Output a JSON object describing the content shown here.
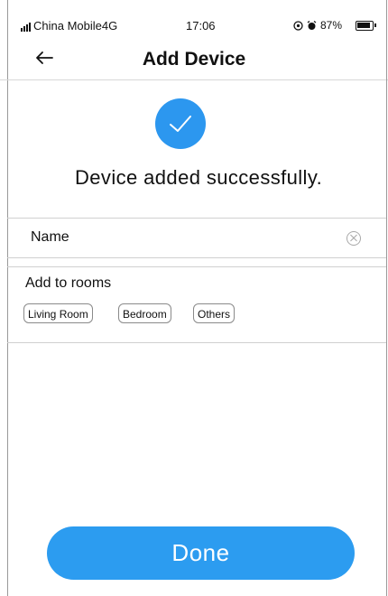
{
  "status_bar": {
    "carrier": "China Mobile4G",
    "time": "17:06",
    "battery": "87%"
  },
  "header": {
    "back_icon": "arrow-left-icon",
    "title": "Add Device"
  },
  "success": {
    "icon": "check-icon",
    "message": "Device added successfully."
  },
  "form": {
    "name_label": "Name",
    "clear_icon": "clear-circle-icon"
  },
  "rooms": {
    "label": "Add to rooms",
    "options": [
      "Living Room",
      "Bedroom",
      "Others"
    ]
  },
  "footer": {
    "done_label": "Done"
  },
  "colors": {
    "accent": "#2C97EF"
  }
}
